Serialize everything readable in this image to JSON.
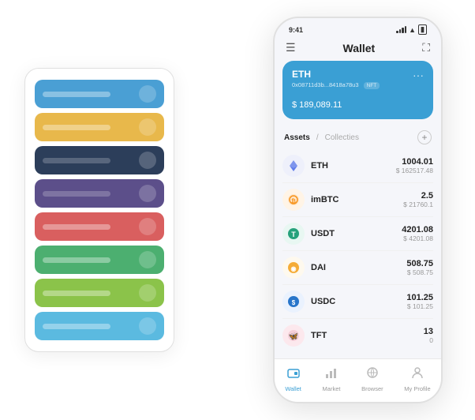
{
  "phone": {
    "status_bar": {
      "time": "9:41",
      "signal_label": "signal",
      "wifi_label": "wifi",
      "battery_label": "battery"
    },
    "header": {
      "menu_icon": "☰",
      "title": "Wallet",
      "expand_icon": "⛶"
    },
    "eth_card": {
      "name": "ETH",
      "address": "0x08711d3b...8418a78u3",
      "nft_badge": "NFT",
      "dots": "···",
      "currency_symbol": "$",
      "balance": "189,089.11"
    },
    "assets_section": {
      "tab_active": "Assets",
      "tab_separator": "/",
      "tab_inactive": "Collecties",
      "add_icon": "+"
    },
    "assets": [
      {
        "symbol": "ETH",
        "icon": "◈",
        "icon_color": "#627eea",
        "amount": "1004.01",
        "usd": "$ 162517.48"
      },
      {
        "symbol": "imBTC",
        "icon": "⊙",
        "icon_color": "#f7931a",
        "amount": "2.5",
        "usd": "$ 21760.1"
      },
      {
        "symbol": "USDT",
        "icon": "T",
        "icon_color": "#26a17b",
        "amount": "4201.08",
        "usd": "$ 4201.08"
      },
      {
        "symbol": "DAI",
        "icon": "◉",
        "icon_color": "#f5ac37",
        "amount": "508.75",
        "usd": "$ 508.75"
      },
      {
        "symbol": "USDC",
        "icon": "$",
        "icon_color": "#2775ca",
        "amount": "101.25",
        "usd": "$ 101.25"
      },
      {
        "symbol": "TFT",
        "icon": "🦋",
        "icon_color": "#e06c85",
        "amount": "13",
        "usd": "0"
      }
    ],
    "nav": [
      {
        "label": "Wallet",
        "icon": "◎",
        "active": true
      },
      {
        "label": "Market",
        "icon": "📊",
        "active": false
      },
      {
        "label": "Browser",
        "icon": "👤",
        "active": false
      },
      {
        "label": "My Profile",
        "icon": "👤",
        "active": false
      }
    ]
  },
  "card_stack": {
    "cards": [
      {
        "color": "card-blue",
        "line": "card-line-blue"
      },
      {
        "color": "card-yellow",
        "line": "card-line-blue"
      },
      {
        "color": "card-dark",
        "line": "card-line-dark"
      },
      {
        "color": "card-purple",
        "line": "card-line-dark"
      },
      {
        "color": "card-red",
        "line": "card-line-blue"
      },
      {
        "color": "card-green",
        "line": "card-line-blue"
      },
      {
        "color": "card-light-green",
        "line": "card-line-blue"
      },
      {
        "color": "card-light-blue",
        "line": "card-line-blue"
      }
    ]
  }
}
